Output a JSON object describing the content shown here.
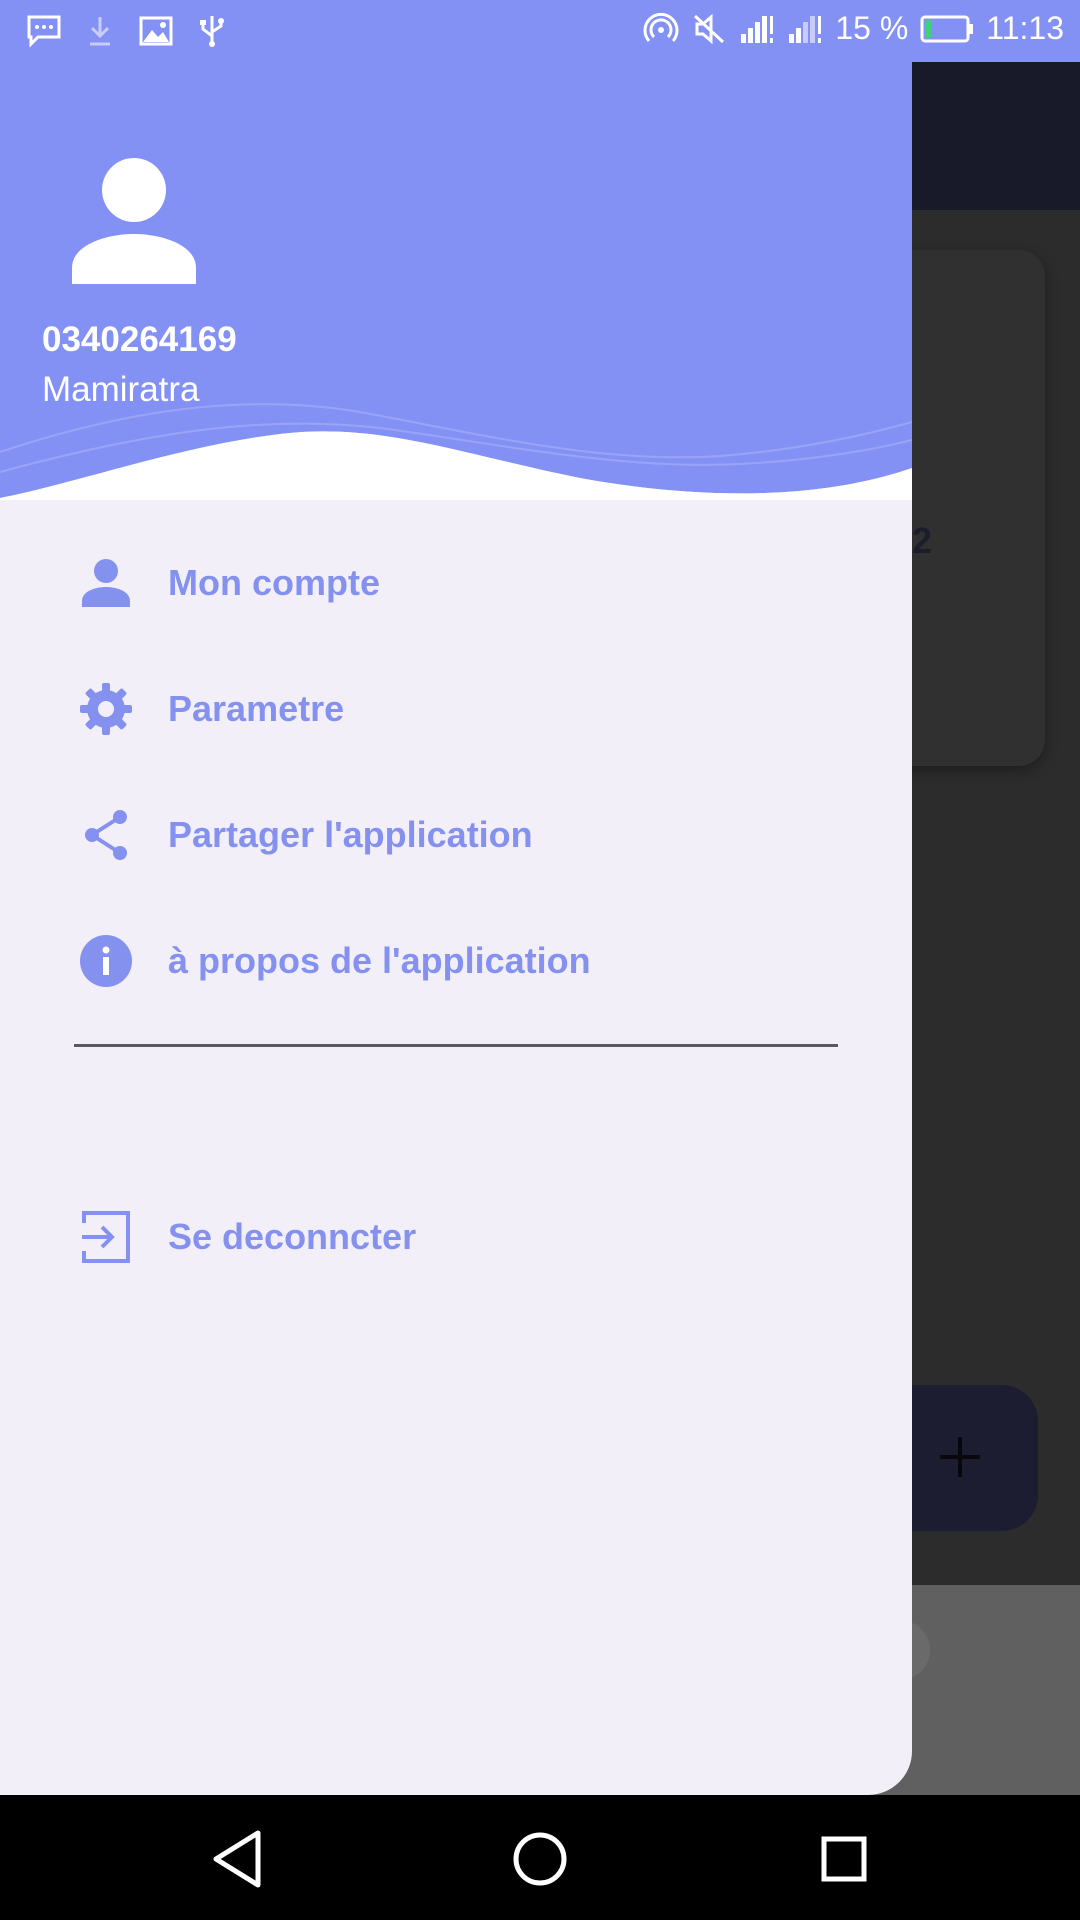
{
  "status_bar": {
    "battery_text": "15 %",
    "time": "11:13",
    "battery_level": 0.15
  },
  "background_app": {
    "card_partial_text": ":22"
  },
  "drawer": {
    "user": {
      "phone": "0340264169",
      "name": "Mamiratra"
    },
    "menu": [
      {
        "icon": "person-icon",
        "label": "Mon compte"
      },
      {
        "icon": "gear-icon",
        "label": "Parametre"
      },
      {
        "icon": "share-icon",
        "label": "Partager l'application"
      },
      {
        "icon": "info-icon",
        "label": "à propos de l'application"
      }
    ],
    "logout": {
      "icon": "logout-icon",
      "label": "Se deconncter"
    }
  },
  "colors": {
    "accent": "#8491f4",
    "drawer_background": "#f3eff8",
    "menu_text": "#8591ee"
  }
}
